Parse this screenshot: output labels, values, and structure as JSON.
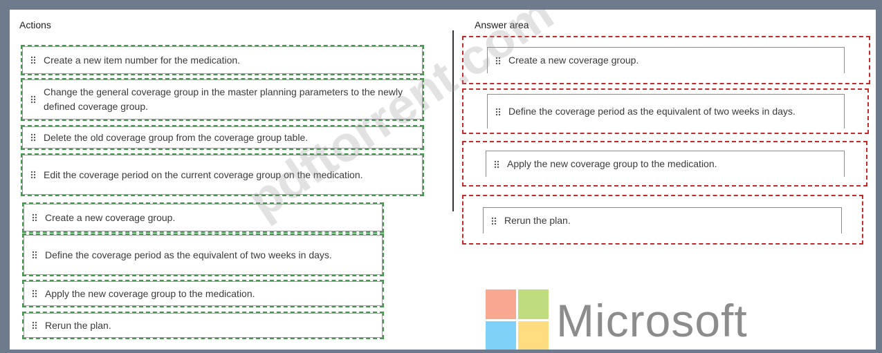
{
  "actions": {
    "title": "Actions",
    "items": [
      {
        "label": "Create a new item number for the medication."
      },
      {
        "label": "Change the general coverage group in the master planning parameters to the newly defined coverage group."
      },
      {
        "label": "Delete the old coverage group from the coverage group table."
      },
      {
        "label": "Edit the coverage period on the current coverage group on the medication."
      },
      {
        "label": "Create a new coverage group."
      },
      {
        "label": "Define the coverage period as the equivalent of two weeks in days."
      },
      {
        "label": "Apply the new coverage group to the medication."
      },
      {
        "label": "Rerun the plan."
      }
    ]
  },
  "answer_area": {
    "title": "Answer area",
    "items": [
      {
        "label": "Create a new coverage group."
      },
      {
        "label": "Define the coverage period as the equivalent of two weeks in days."
      },
      {
        "label": "Apply the new coverage group to the medication."
      },
      {
        "label": "Rerun the plan."
      }
    ]
  },
  "watermark": "pdftorrent.com",
  "logo": {
    "text": "Microsoft",
    "colors": {
      "red": "#f25022",
      "green": "#7fba00",
      "blue": "#00a4ef",
      "yellow": "#ffb900"
    }
  },
  "icons": {
    "grip": "drag-handle-icon"
  },
  "colors": {
    "actions_outline": "#3f9a4a",
    "answer_outline": "#c62828",
    "background": "#6e7b8c"
  }
}
